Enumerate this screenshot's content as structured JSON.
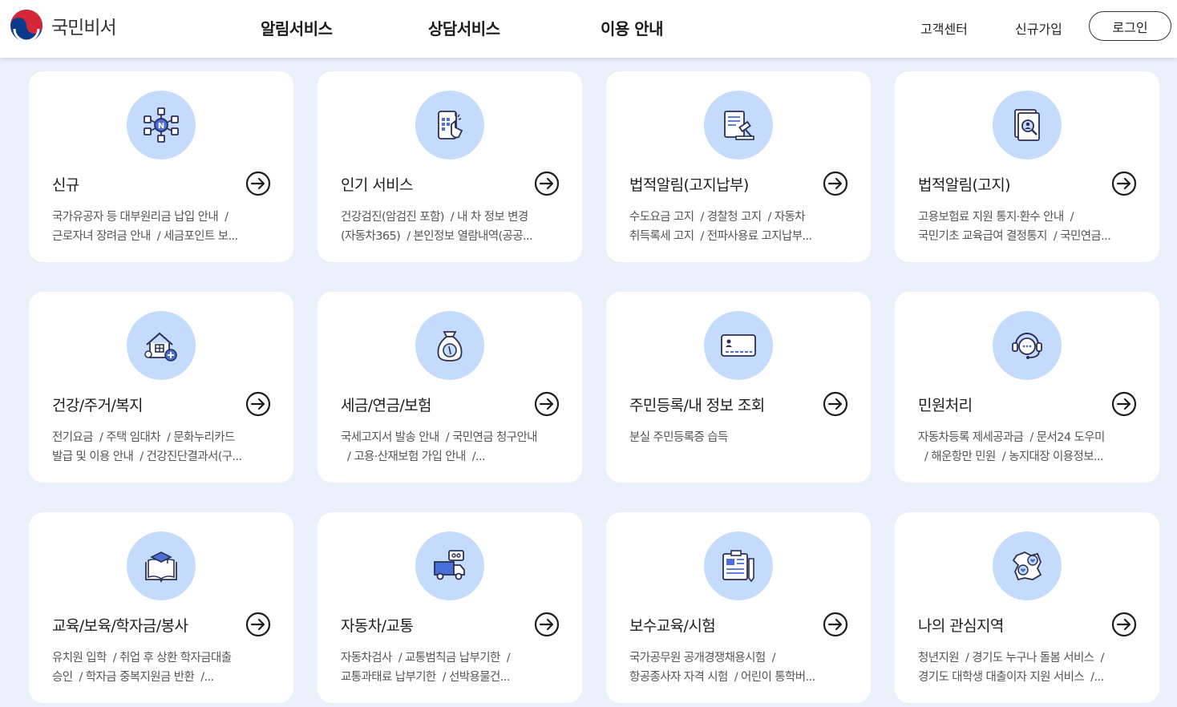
{
  "header": {
    "logo_text": "국민비서",
    "nav": [
      "알림서비스",
      "상담서비스",
      "이용 안내"
    ],
    "util": [
      "고객센터",
      "신규가입"
    ],
    "login": "로그인"
  },
  "colors": {
    "background": "#eaf1fb",
    "icon_circle": "#c4dbfb",
    "icon_stroke": "#2b2f55",
    "icon_accent": "#4a6fd8"
  },
  "cards": [
    {
      "title": "신규",
      "icon": "network-icon",
      "desc": "국가유공자 등 대부원리금 납입 안내  /\n근로자녀 장려금 안내  / 세금포인트 보..."
    },
    {
      "title": "인기 서비스",
      "icon": "phone-touch-icon",
      "desc": "건강검진(암검진 포함)  / 내 차 정보 변경\n(자동차365)  / 본인정보 열람내역(공공..."
    },
    {
      "title": "법적알림(고지납부)",
      "icon": "gavel-document-icon",
      "desc": "수도요금 고지  / 경찰청 고지  / 자동차\n취득록세 고지  / 전파사용료 고지납부..."
    },
    {
      "title": "법적알림(고지)",
      "icon": "document-search-icon",
      "desc": "고용보험료 지원 통지·환수 안내  /\n국민기초 교육급여 결정통지  / 국민연금..."
    },
    {
      "title": "건강/주거/복지",
      "icon": "house-plus-icon",
      "desc": "전기요금  / 주택 임대차  / 문화누리카드\n발급 및 이용 안내  / 건강진단결과서(구..."
    },
    {
      "title": "세금/연금/보험",
      "icon": "money-bag-icon",
      "desc": "국세고지서 발송 안내  / 국민연금 청구안내\n  / 고용·산재보험 가입 안내  /..."
    },
    {
      "title": "주민등록/내 정보 조회",
      "icon": "id-card-icon",
      "desc": "분실 주민등록증 습득"
    },
    {
      "title": "민원처리",
      "icon": "headset-icon",
      "desc": "자동차등록 제세공과금  / 문서24 도우미\n  / 해운항만 민원  / 농지대장 이용정보..."
    },
    {
      "title": "교육/보육/학자금/봉사",
      "icon": "graduation-book-icon",
      "desc": "유치원 입학  / 취업 후 상환 학자금대출\n승인  / 학자금 중복지원금 반환  /..."
    },
    {
      "title": "자동차/교통",
      "icon": "truck-icon",
      "desc": "자동차검사  / 교통범칙금 납부기한  /\n교통과태료 납부기한  / 선박용물건..."
    },
    {
      "title": "보수교육/시험",
      "icon": "newspaper-pencil-icon",
      "desc": "국가공무원 공개경쟁채용시험  /\n항공종사자 자격 시험  / 어린이 통학버..."
    },
    {
      "title": "나의 관심지역",
      "icon": "map-heart-icon",
      "desc": "청년지원  / 경기도 누구나 돌봄 서비스  /\n경기도 대학생 대출이자 지원 서비스  /..."
    }
  ]
}
